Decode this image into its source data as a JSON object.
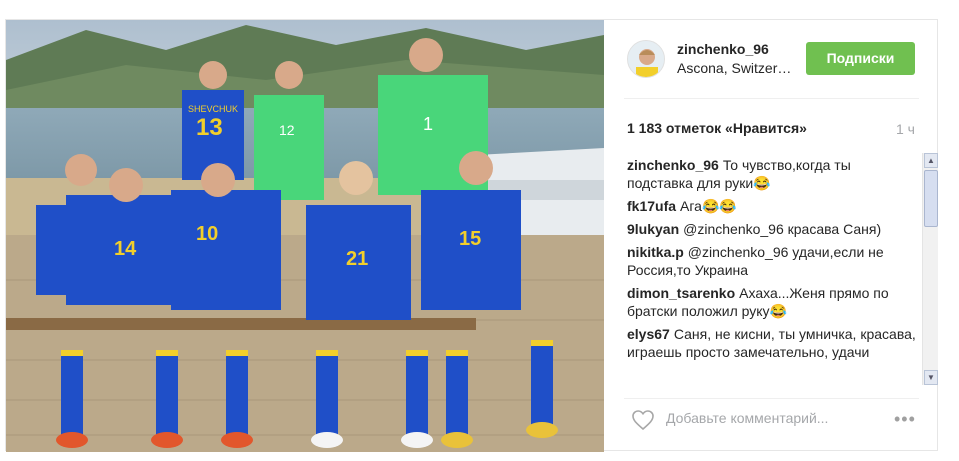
{
  "post": {
    "username": "zinchenko_96",
    "location": "Ascona, Switzerland",
    "follow_label": "Подписки",
    "likes": "1 183 отметок «Нравится»",
    "time": "1 ч",
    "comment_placeholder": "Добавьте комментарий...",
    "more_label": "•••"
  },
  "photo": {
    "jersey_numbers": [
      "14",
      "10",
      "13",
      "12",
      "1",
      "21",
      "15"
    ],
    "jersey_name": "SHEVCHUK"
  },
  "comments": [
    {
      "author": "zinchenko_96",
      "text": "То чувство,когда ты подставка для руки😂"
    },
    {
      "author": "fk17ufa",
      "text": "Ага😂😂"
    },
    {
      "author": "9lukyan",
      "text": "@zinchenko_96 красава Саня)"
    },
    {
      "author": "nikitka.p",
      "text": "@zinchenko_96 удачи,если не Россия,то Украина"
    },
    {
      "author": "dimon_tsarenko",
      "text": "Ахаха...Женя прямо по братски положил руку😂"
    },
    {
      "author": "elys67",
      "text": "Саня, не кисни, ты умничка, красава, играешь просто замечательно, удачи"
    }
  ],
  "colors": {
    "follow_button": "#70c050",
    "kit_blue": "#1f4fc8",
    "kit_yellow": "#f2cf2b",
    "goalkeeper_green": "#49d67a"
  }
}
